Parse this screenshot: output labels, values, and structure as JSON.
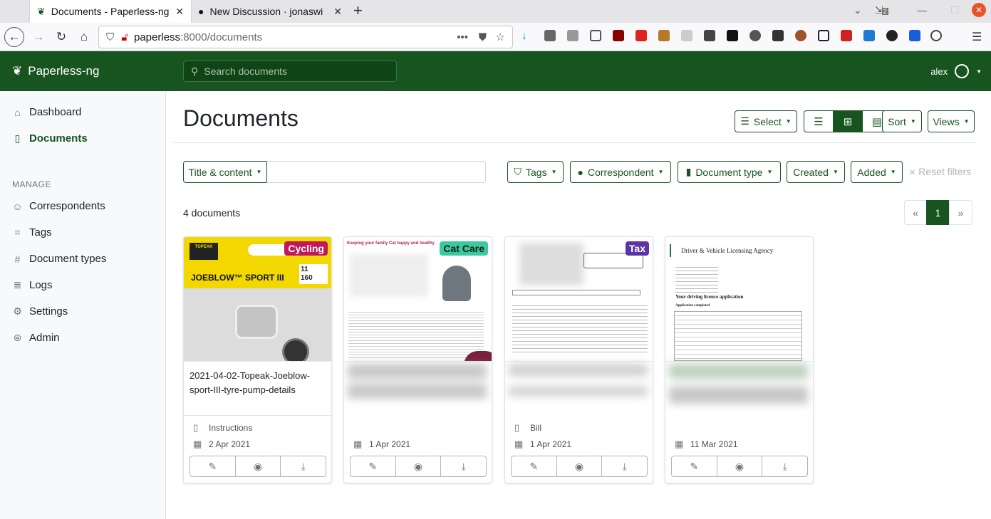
{
  "browser": {
    "tabs": [
      {
        "title": "Documents - Paperless-ng",
        "active": true
      },
      {
        "title": "New Discussion · jonaswi",
        "active": false
      }
    ],
    "url_host": "paperless",
    "url_path": ":8000/documents",
    "download_count": "2"
  },
  "app": {
    "brand": "Paperless-ng",
    "search_placeholder": "Search documents",
    "username": "alex"
  },
  "sidebar": {
    "items": [
      {
        "label": "Dashboard",
        "icon": "house-icon"
      },
      {
        "label": "Documents",
        "icon": "file-icon",
        "active": true
      }
    ],
    "manage_heading": "MANAGE",
    "manage_items": [
      {
        "label": "Correspondents",
        "icon": "person-icon"
      },
      {
        "label": "Tags",
        "icon": "tag-icon"
      },
      {
        "label": "Document types",
        "icon": "hash-icon"
      },
      {
        "label": "Logs",
        "icon": "list-icon"
      },
      {
        "label": "Settings",
        "icon": "gear-icon"
      },
      {
        "label": "Admin",
        "icon": "toggles-icon"
      }
    ]
  },
  "page": {
    "title": "Documents",
    "select_label": "Select",
    "sort_label": "Sort",
    "views_label": "Views",
    "view_mode": "grid"
  },
  "filters": {
    "text_filter_label": "Title & content",
    "tags_label": "Tags",
    "correspondent_label": "Correspondent",
    "document_type_label": "Document type",
    "created_label": "Created",
    "added_label": "Added",
    "reset_label": "Reset filters"
  },
  "results": {
    "count_label": "4 documents",
    "pager": {
      "prev": "«",
      "current": "1",
      "next": "»"
    }
  },
  "documents": [
    {
      "title": "2021-04-02-Topeak-Joeblow-sport-III-tyre-pump-details",
      "tag": "Cycling",
      "tag_color": "#c2185b",
      "document_type": "Instructions",
      "date": "2 Apr 2021"
    },
    {
      "title": "",
      "tag": "Cat Care",
      "tag_color": "#3cc9a0",
      "document_type": "",
      "date": "1 Apr 2021"
    },
    {
      "title": "",
      "tag": "Tax",
      "tag_color": "#5c35a5",
      "document_type": "Bill",
      "date": "1 Apr 2021"
    },
    {
      "title": "",
      "tag": "",
      "tag_color": "",
      "document_type": "",
      "date": "11 Mar 2021"
    }
  ],
  "thumbnails": {
    "pump_brand": "TOPEAK",
    "pump_name": "JOEBLOW™ SPORT III",
    "pump_bar": "11",
    "pump_psi": "160",
    "cat_header": "Keeping your family Cat happy and healthy",
    "dvla_agency": "Driver & Vehicle Licensing Agency",
    "dvla_heading": "Your driving licence application",
    "dvla_sub": "Application completed"
  }
}
